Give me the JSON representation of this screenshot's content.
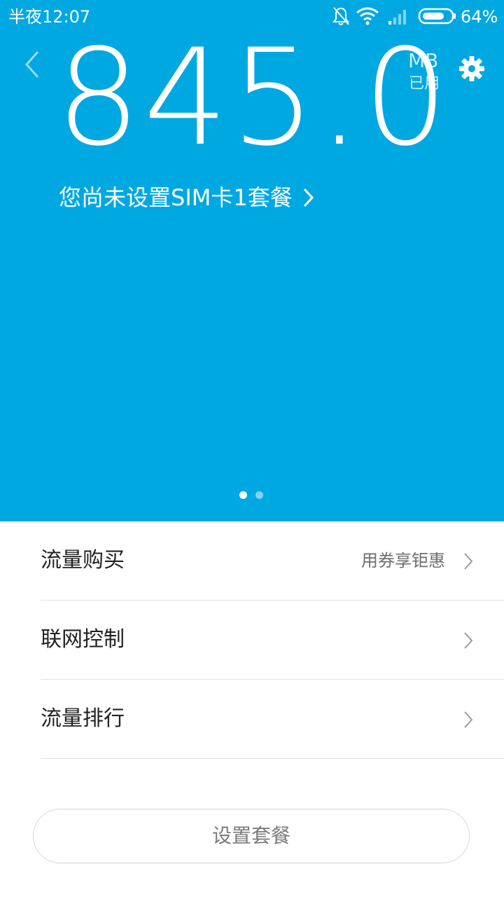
{
  "status_bar": {
    "time": "半夜12:07",
    "battery_percent": "64%",
    "icons": [
      "bell-off-icon",
      "wifi-icon",
      "cellular-signal-icon",
      "battery-icon"
    ]
  },
  "header": {
    "usage_value": "845.0",
    "usage_unit": "MB",
    "usage_caption": "已用",
    "plan_link": "您尚未设置SIM卡1套餐",
    "icons": [
      "back-chevron-icon",
      "gear-icon",
      "chevron-right-icon"
    ]
  },
  "pager": {
    "count": 2,
    "active_index": 0
  },
  "menu": {
    "items": [
      {
        "label": "流量购买",
        "hint": "用券享钜惠"
      },
      {
        "label": "联网控制",
        "hint": ""
      },
      {
        "label": "流量排行",
        "hint": ""
      }
    ]
  },
  "footer": {
    "setup_button": "设置套餐"
  },
  "colors": {
    "hero_background": "#00a8e1",
    "text_primary": "#222222",
    "text_secondary": "#6e6e6e",
    "divider": "#e2e2e2"
  }
}
